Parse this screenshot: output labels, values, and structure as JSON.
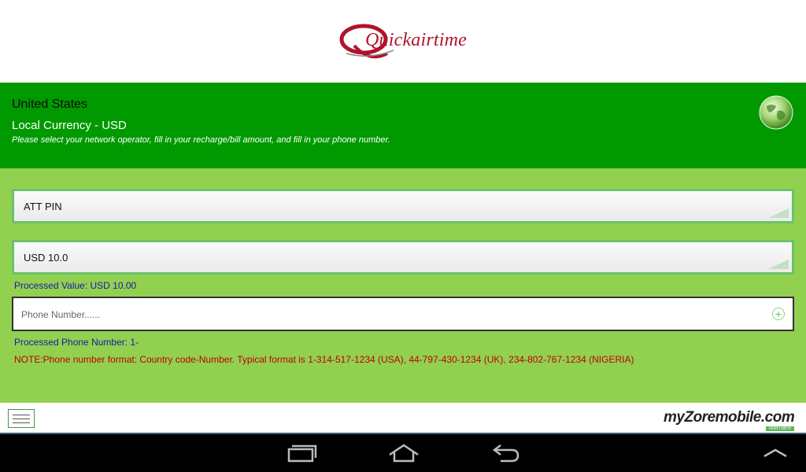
{
  "header": {
    "logo_text": "Quickairtime"
  },
  "info": {
    "country": "United States",
    "currency": "Local Currency - USD",
    "instructions": "Please select your network operator, fill in your recharge/bill amount, and fill in your phone number."
  },
  "form": {
    "operator": "ATT PIN",
    "amount": "USD 10.0",
    "processed_value": "Processed Value: USD 10.00",
    "phone_placeholder": "Phone Number......",
    "processed_phone": "Processed Phone Number: 1-",
    "note": "NOTE:Phone number format: Country code-Number. Typical format is 1-314-517-1234 (USA), 44-797-430-1234 (UK), 234-802-767-1234 (NIGERIA)"
  },
  "footer": {
    "brand_text": "myZoremobile.com",
    "brand_badge": "PARTNER"
  },
  "colors": {
    "green_bar": "#009a00",
    "form_bg": "#92d050",
    "logo_red": "#b0132b",
    "note_red": "#c00000",
    "info_blue": "#1a1aa6"
  },
  "icons": {
    "globe": "globe-icon",
    "add": "plus-circle-icon",
    "menu": "hamburger-menu-icon",
    "recent_apps": "recent-apps-icon",
    "home": "home-icon",
    "back": "back-icon",
    "up": "chevron-up-icon"
  }
}
